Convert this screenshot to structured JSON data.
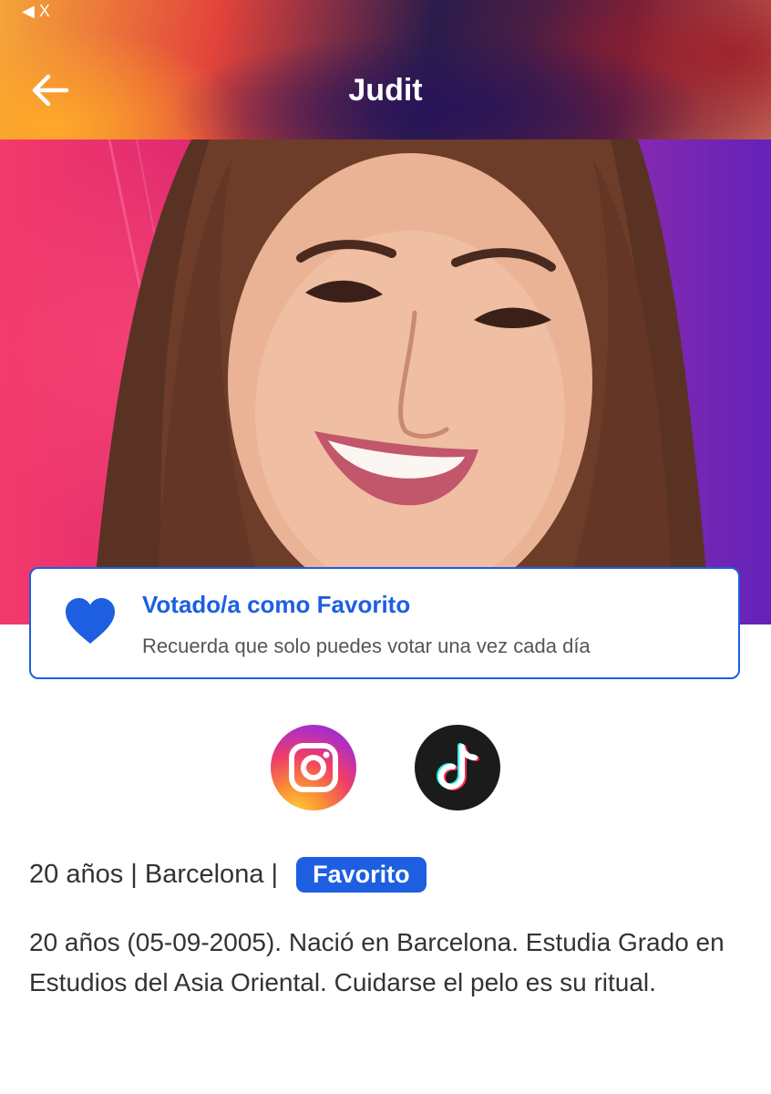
{
  "status_bar": {
    "text": "◀ X"
  },
  "header": {
    "title": "Judit"
  },
  "hero": {
    "image_description_icon": "contestant-portrait"
  },
  "vote_card": {
    "title": "Votado/a como Favorito",
    "subtitle": "Recuerda que solo puedes votar una vez cada día",
    "icon": "heart-icon"
  },
  "social": [
    {
      "icon": "instagram-icon"
    },
    {
      "icon": "tiktok-icon"
    }
  ],
  "info": {
    "age": "20 años",
    "separator1": " | ",
    "city": "Barcelona",
    "separator2": " | ",
    "badge": "Favorito"
  },
  "bio": "20 años (05-09-2005). Nació en Barcelona. Estudia Grado en Estudios del Asia Oriental. Cuidarse el pelo es su ritual.",
  "colors": {
    "accent": "#1d5fe0",
    "text": "#333333"
  }
}
